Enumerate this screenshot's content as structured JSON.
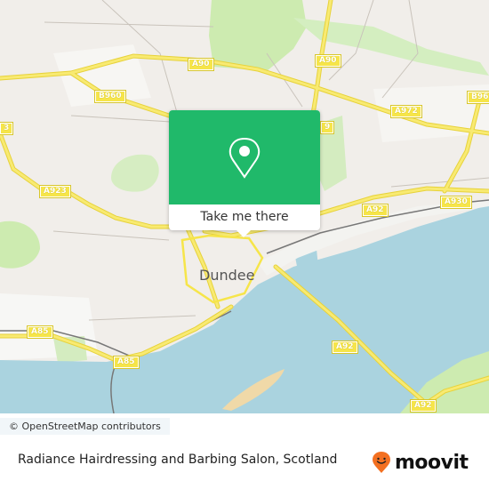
{
  "map": {
    "city_label": "Dundee",
    "road_labels": [
      {
        "id": "a90-west",
        "text": "A90"
      },
      {
        "id": "a90-east",
        "text": "A90"
      },
      {
        "id": "b960",
        "text": "B960"
      },
      {
        "id": "a972",
        "text": "A972"
      },
      {
        "id": "b96-edge",
        "text": "B96"
      },
      {
        "id": "a9-edge",
        "text": "9"
      },
      {
        "id": "a923-edge",
        "text": "3"
      },
      {
        "id": "a923",
        "text": "A923"
      },
      {
        "id": "a92-north",
        "text": "A92"
      },
      {
        "id": "a930",
        "text": "A930"
      },
      {
        "id": "a85-west",
        "text": "A85"
      },
      {
        "id": "a85-south",
        "text": "A85"
      },
      {
        "id": "a92-bridge",
        "text": "A92"
      },
      {
        "id": "a92-south",
        "text": "A92"
      }
    ],
    "colors": {
      "land": "#f2efe9",
      "water": "#aad3df",
      "park": "#cdebb0",
      "road": "#f6e54a",
      "sand": "#f0d9a8",
      "accent": "#20b96a"
    }
  },
  "popup": {
    "icon": "location-pin-icon",
    "button_label": "Take me there"
  },
  "attribution": "© OpenStreetMap contributors",
  "footer": {
    "title": "Radiance Hairdressing and Barbing Salon, Scotland",
    "brand": "moovit",
    "brand_color": "#f37021"
  }
}
